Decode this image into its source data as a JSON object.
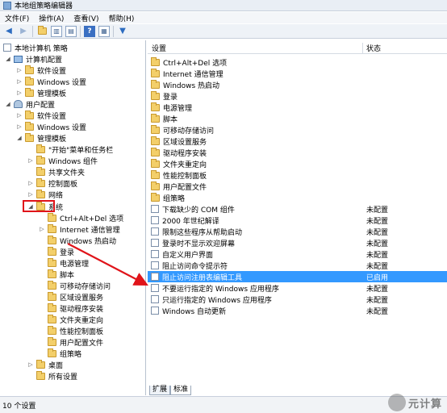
{
  "window": {
    "title": "本地组策略编辑器"
  },
  "menu": [
    "文件(F)",
    "操作(A)",
    "查看(V)",
    "帮助(H)"
  ],
  "tree": {
    "root": "本地计算机 策略",
    "computer_config": "计算机配置",
    "cc_children": [
      "软件设置",
      "Windows 设置",
      "管理模板"
    ],
    "user_config": "用户配置",
    "uc_children": [
      "软件设置",
      "Windows 设置",
      "管理模板"
    ],
    "admin_templates": [
      "\"开始\"菜单和任务栏",
      "Windows 组件",
      "共享文件夹",
      "控制面板",
      "网络",
      "系统"
    ],
    "system_children": [
      "Ctrl+Alt+Del 选项",
      "Internet 通信管理",
      "Windows 热启动",
      "登录",
      "电源管理",
      "脚本",
      "可移动存储访问",
      "区域设置服务",
      "驱动程序安装",
      "文件夹重定向",
      "性能控制面板",
      "用户配置文件",
      "组策略"
    ],
    "after_system": [
      "桌面",
      "所有设置"
    ]
  },
  "list": {
    "header_setting": "设置",
    "header_state": "状态",
    "folders": [
      "Ctrl+Alt+Del 选项",
      "Internet 通信管理",
      "Windows 热启动",
      "登录",
      "电源管理",
      "脚本",
      "可移动存储访问",
      "区域设置服务",
      "驱动程序安装",
      "文件夹重定向",
      "性能控制面板",
      "用户配置文件",
      "组策略"
    ],
    "policies": [
      {
        "name": "下载缺少的 COM 组件",
        "state": "未配置"
      },
      {
        "name": "2000 年世纪解译",
        "state": "未配置"
      },
      {
        "name": "限制这些程序从帮助启动",
        "state": "未配置"
      },
      {
        "name": "登录时不显示欢迎屏幕",
        "state": "未配置"
      },
      {
        "name": "自定义用户界面",
        "state": "未配置"
      },
      {
        "name": "阻止访问命令提示符",
        "state": "未配置"
      },
      {
        "name": "阻止访问注册表编辑工具",
        "state": "已启用"
      },
      {
        "name": "不要运行指定的 Windows 应用程序",
        "state": "未配置"
      },
      {
        "name": "只运行指定的 Windows 应用程序",
        "state": "未配置"
      },
      {
        "name": "Windows 自动更新",
        "state": "未配置"
      }
    ]
  },
  "tabs": [
    "扩展",
    "标准"
  ],
  "status": "10 个设置",
  "watermark": "元计算",
  "colors": {
    "selected": "#3399ff",
    "highlight": "#e0141a",
    "arrow": "#e0141a"
  }
}
